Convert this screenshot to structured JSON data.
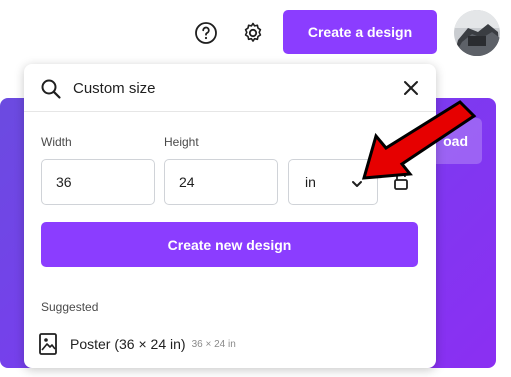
{
  "topbar": {
    "create_label": "Create a design",
    "help_icon": "question-circle-icon",
    "settings_icon": "gear-icon",
    "avatar": "user-avatar"
  },
  "banner": {
    "button_label": "oad"
  },
  "dropdown": {
    "search_value": "Custom size",
    "search_icon": "search-icon",
    "close_icon": "close-icon",
    "width_label": "Width",
    "height_label": "Height",
    "width_value": "36",
    "height_value": "24",
    "unit_value": "in",
    "create_new_label": "Create new design",
    "suggested_label": "Suggested",
    "suggestions": [
      {
        "title": "Poster (36 × 24 in)",
        "dims": "36 × 24 in",
        "icon": "poster-icon"
      }
    ]
  },
  "colors": {
    "accent": "#8b3dff",
    "annotation": "#e60000"
  }
}
